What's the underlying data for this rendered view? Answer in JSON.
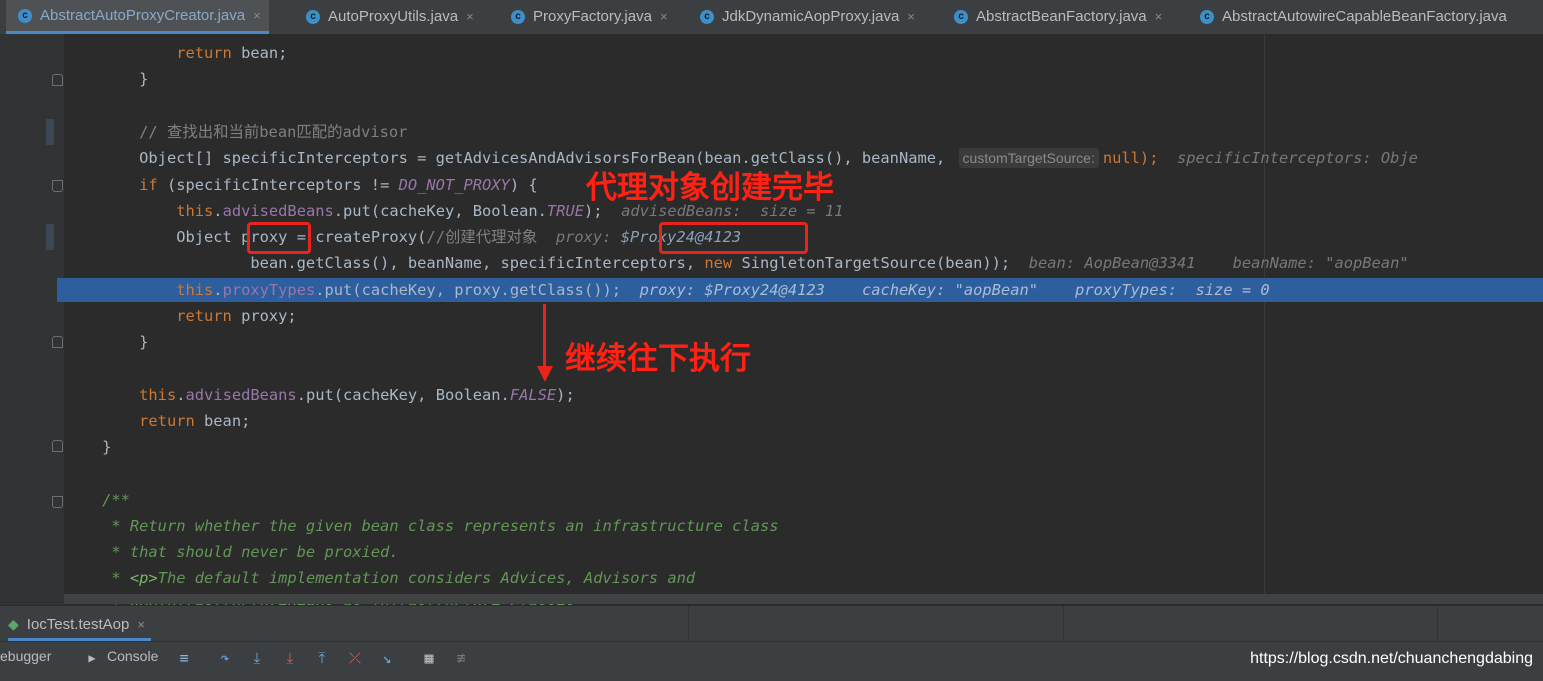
{
  "tabs": [
    {
      "label": "AbstractAutoProxyCreator.java",
      "active": true
    },
    {
      "label": "AutoProxyUtils.java"
    },
    {
      "label": "ProxyFactory.java"
    },
    {
      "label": "JdkDynamicAopProxy.java"
    },
    {
      "label": "AbstractBeanFactory.java"
    },
    {
      "label": "AbstractAutowireCapableBeanFactory.java"
    }
  ],
  "file_icon_letter": "c",
  "close_glyph": "×",
  "code": {
    "l1": {
      "kw": "return",
      "rest": " bean;"
    },
    "l2": "}",
    "l4": "// 查找出和当前bean匹配的advisor",
    "l5": {
      "a": "Object[] specificInterceptors = getAdvicesAndAdvisorsForBean(bean.getClass(), beanName, ",
      "hint": "customTargetSource:",
      "b": "null",
      "c": ");",
      "inline": "specificInterceptors: Obje"
    },
    "l6": {
      "kw": "if",
      "a": " (specificInterceptors != ",
      "const": "DO_NOT_PROXY",
      "b": ") {"
    },
    "l7": {
      "kw": "this",
      "dot": ".",
      "fld": "advisedBeans",
      "a": ".put(cacheKey, Boolean.",
      "const": "TRUE",
      "b": ");",
      "inline": "advisedBeans:  size = 11"
    },
    "l8": {
      "a": "Object ",
      "var": "proxy",
      "b": " = createProxy(",
      "cmt": "//创建代理对象",
      "inline1": "proxy: ",
      "inline2": "$Proxy24@4123"
    },
    "l9": {
      "a": "bean.getClass(), beanName, specificInterceptors, ",
      "kw": "new",
      "b": " SingletonTargetSource(bean));",
      "inline": "bean: AopBean@3341    beanName: \"aopBean\""
    },
    "l10": {
      "kw": "this",
      "dot": ".",
      "fld": "proxyTypes",
      "a": ".put(cacheKey, proxy.getClass());",
      "inline": "proxy: $Proxy24@4123    cacheKey: \"aopBean\"    proxyTypes:  size = 0"
    },
    "l11": {
      "kw": "return",
      "rest": " proxy;"
    },
    "l12": "}",
    "l14": {
      "kw": "this",
      "dot": ".",
      "fld": "advisedBeans",
      "a": ".put(cacheKey, Boolean.",
      "const": "FALSE",
      "b": ");"
    },
    "l15": {
      "kw": "return",
      "rest": " bean;"
    },
    "l16": "}",
    "l18": "/**",
    "l19": " * Return whether the given bean class represents an infrastructure class",
    "l20": " * that should never be proxied.",
    "l21": {
      "a": " * ",
      "tag": "<p>",
      "b": "The default implementation considers Advices, Advisors and"
    },
    "l22": " * AopInfrastructureBeans as infrastructure classes"
  },
  "annotations": {
    "created": "代理对象创建完毕",
    "continue": "继续往下执行"
  },
  "debug": {
    "tab_label": "IocTest.testAop",
    "debugger_label": "ebugger",
    "console_label": "Console"
  },
  "watermark": "https://blog.csdn.net/chuanchengdabing",
  "colors": {
    "keyword": "#cc7832",
    "field": "#9876aa",
    "comment": "#808080",
    "doc": "#629755",
    "execution_line": "#2d5e9e",
    "annotation_red": "#e8241b"
  }
}
